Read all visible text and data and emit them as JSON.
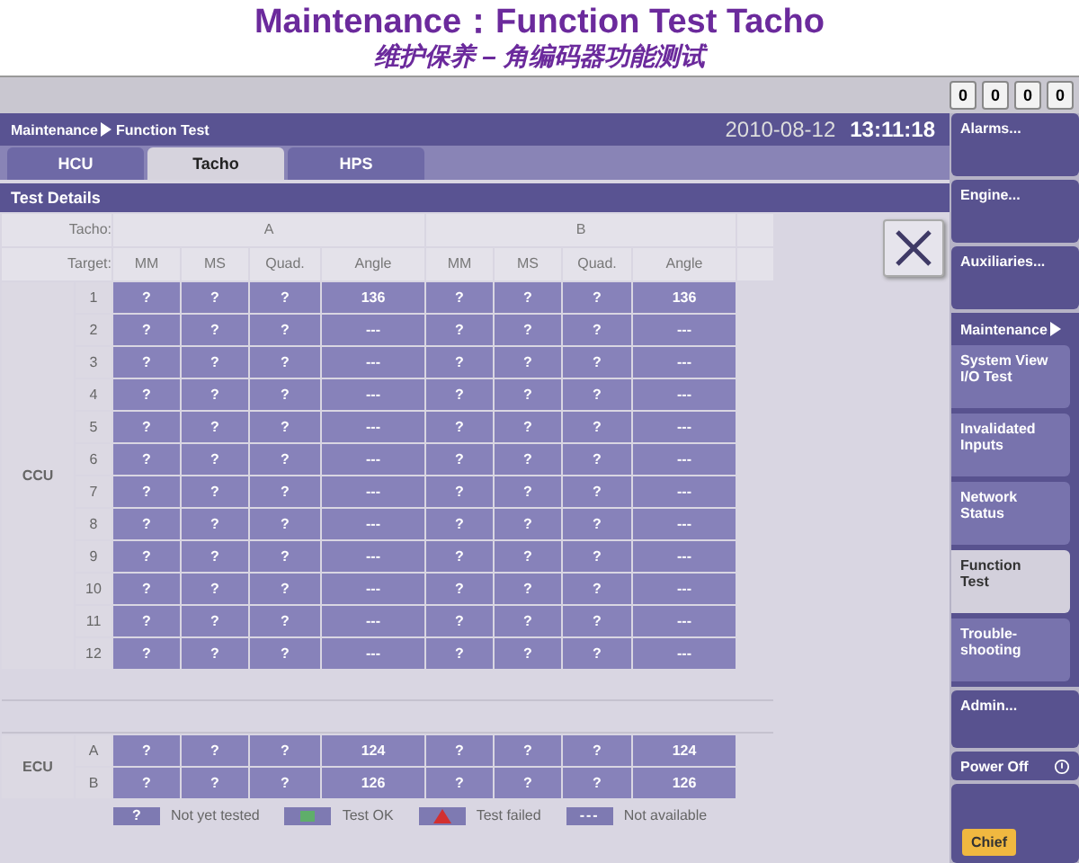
{
  "slide": {
    "title": "Maintenance：Function Test Tacho",
    "subtitle": "维护保养 – 角编码器功能测试"
  },
  "counters": [
    "0",
    "0",
    "0",
    "0"
  ],
  "breadcrumb": [
    "Maintenance",
    "Function Test"
  ],
  "date": "2010-08-12",
  "time": "13:11:18",
  "tabs": [
    {
      "label": "HCU",
      "selected": false
    },
    {
      "label": "Tacho",
      "selected": true
    },
    {
      "label": "HPS",
      "selected": false
    }
  ],
  "section_title": "Test Details",
  "table": {
    "tacho_label": "Tacho:",
    "target_label": "Target:",
    "groups": [
      "A",
      "B"
    ],
    "columns": [
      "MM",
      "MS",
      "Quad.",
      "Angle",
      "MM",
      "MS",
      "Quad.",
      "Angle"
    ],
    "sections": [
      {
        "label": "CCU",
        "rows": [
          {
            "label": "1",
            "cells": [
              "?",
              "?",
              "?",
              "136",
              "?",
              "?",
              "?",
              "136"
            ]
          },
          {
            "label": "2",
            "cells": [
              "?",
              "?",
              "?",
              "---",
              "?",
              "?",
              "?",
              "---"
            ]
          },
          {
            "label": "3",
            "cells": [
              "?",
              "?",
              "?",
              "---",
              "?",
              "?",
              "?",
              "---"
            ]
          },
          {
            "label": "4",
            "cells": [
              "?",
              "?",
              "?",
              "---",
              "?",
              "?",
              "?",
              "---"
            ]
          },
          {
            "label": "5",
            "cells": [
              "?",
              "?",
              "?",
              "---",
              "?",
              "?",
              "?",
              "---"
            ]
          },
          {
            "label": "6",
            "cells": [
              "?",
              "?",
              "?",
              "---",
              "?",
              "?",
              "?",
              "---"
            ]
          },
          {
            "label": "7",
            "cells": [
              "?",
              "?",
              "?",
              "---",
              "?",
              "?",
              "?",
              "---"
            ]
          },
          {
            "label": "8",
            "cells": [
              "?",
              "?",
              "?",
              "---",
              "?",
              "?",
              "?",
              "---"
            ]
          },
          {
            "label": "9",
            "cells": [
              "?",
              "?",
              "?",
              "---",
              "?",
              "?",
              "?",
              "---"
            ]
          },
          {
            "label": "10",
            "cells": [
              "?",
              "?",
              "?",
              "---",
              "?",
              "?",
              "?",
              "---"
            ]
          },
          {
            "label": "11",
            "cells": [
              "?",
              "?",
              "?",
              "---",
              "?",
              "?",
              "?",
              "---"
            ]
          },
          {
            "label": "12",
            "cells": [
              "?",
              "?",
              "?",
              "---",
              "?",
              "?",
              "?",
              "---"
            ]
          }
        ]
      },
      {
        "label": "ECU",
        "rows": [
          {
            "label": "A",
            "cells": [
              "?",
              "?",
              "?",
              "124",
              "?",
              "?",
              "?",
              "124"
            ]
          },
          {
            "label": "B",
            "cells": [
              "?",
              "?",
              "?",
              "126",
              "?",
              "?",
              "?",
              "126"
            ]
          }
        ]
      }
    ]
  },
  "legend": [
    {
      "kind": "not_tested",
      "swatch": "?",
      "label": "Not yet tested"
    },
    {
      "kind": "ok",
      "label": "Test OK"
    },
    {
      "kind": "failed",
      "label": "Test failed"
    },
    {
      "kind": "na",
      "swatch": "---",
      "label": "Not available"
    }
  ],
  "sidebar": {
    "top_buttons": [
      "Alarms...",
      "Engine...",
      "Auxiliaries..."
    ],
    "submenu_title": "Maintenance",
    "submenu": [
      {
        "label": "System View\nI/O Test",
        "selected": false
      },
      {
        "label": "Invalidated\nInputs",
        "selected": false
      },
      {
        "label": "Network\nStatus",
        "selected": false
      },
      {
        "label": "Function\nTest",
        "selected": true
      },
      {
        "label": "Trouble-\nshooting",
        "selected": false
      }
    ],
    "admin": "Admin...",
    "power": "Power Off",
    "user": "Chief"
  }
}
